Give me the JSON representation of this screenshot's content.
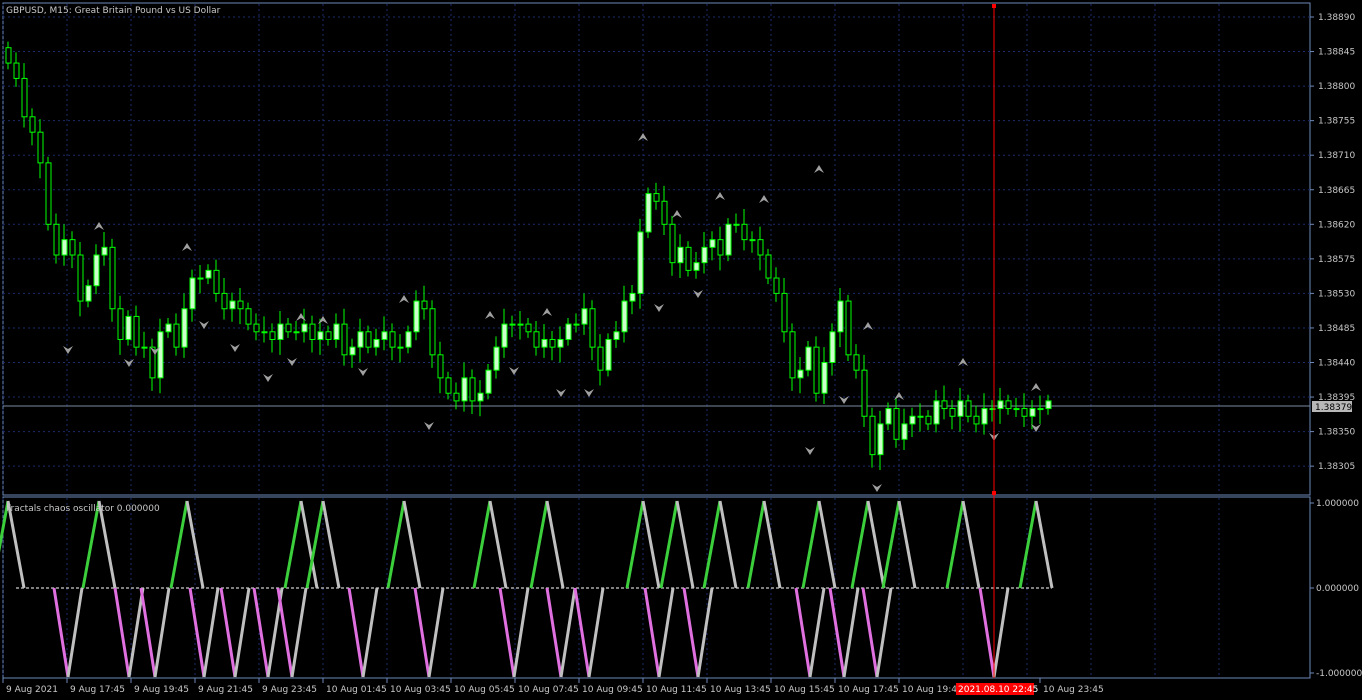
{
  "main_title": "GBPUSD, M15:  Great Britain Pound vs US Dollar",
  "osc_title": "Fractals chaos oscillator 0.000000",
  "current_price": "1.38379",
  "hover_time": "2021.08.10 22:45",
  "colors": {
    "background": "#000000",
    "grid": "#1c2b6b",
    "frame": "#6b8ab8",
    "bull_candle": "#00ff00",
    "bull_body": "#ccffcc",
    "bear_candle": "#00ff00",
    "bear_body": "#000000",
    "fractal": "#a0a0a0",
    "osc_up": "#3ccf3c",
    "osc_down": "#e070e0",
    "osc_neutral": "#c0c0c0",
    "crosshair": "#ff0000"
  },
  "price_axis": [
    "1.38890",
    "1.38845",
    "1.38800",
    "1.38755",
    "1.38710",
    "1.38665",
    "1.38620",
    "1.38575",
    "1.38530",
    "1.38485",
    "1.38440",
    "1.38395",
    "1.38350",
    "1.38305"
  ],
  "osc_axis": [
    "1.000000",
    "0.000000",
    "-1.000000"
  ],
  "time_axis": [
    "9 Aug 2021",
    "9 Aug 17:45",
    "9 Aug 19:45",
    "9 Aug 21:45",
    "9 Aug 23:45",
    "10 Aug 01:45",
    "10 Aug 03:45",
    "10 Aug 05:45",
    "10 Aug 07:45",
    "10 Aug 09:45",
    "10 Aug 11:45",
    "10 Aug 13:45",
    "10 Aug 15:45",
    "10 Aug 17:45",
    "10 Aug 19:45",
    "10 Aug 23:45"
  ]
}
